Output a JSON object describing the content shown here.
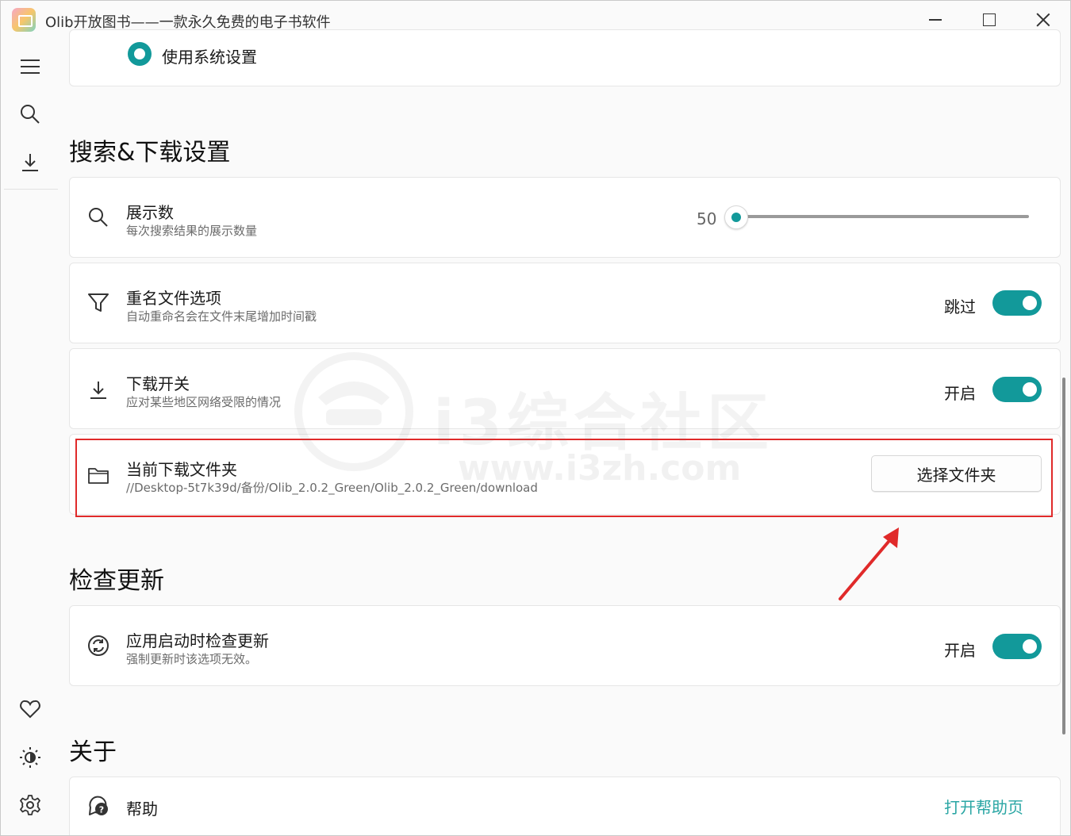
{
  "window": {
    "title": "Olib开放图书——一款永久免费的电子书软件"
  },
  "nav": {
    "icons": [
      "menu-icon",
      "search-icon",
      "download-icon",
      "heart-icon",
      "theme-icon",
      "settings-icon"
    ]
  },
  "theme_option": {
    "label": "使用系统设置",
    "selected": true
  },
  "sections": {
    "search_download": "搜索&下载设置",
    "check_update": "检查更新",
    "about": "关于"
  },
  "display_count": {
    "title": "展示数",
    "desc": "每次搜索结果的展示数量",
    "value": "50"
  },
  "rename_option": {
    "title": "重名文件选项",
    "desc": "自动重命名会在文件末尾增加时间戳",
    "toggle_label": "跳过",
    "on": true
  },
  "download_switch": {
    "title": "下载开关",
    "desc": "应对某些地区网络受限的情况",
    "toggle_label": "开启",
    "on": true
  },
  "download_folder": {
    "title": "当前下载文件夹",
    "path": "//Desktop-5t7k39d/备份/Olib_2.0.2_Green/Olib_2.0.2_Green/download",
    "button": "选择文件夹"
  },
  "auto_update": {
    "title": "应用启动时检查更新",
    "desc": "强制更新时该选项无效。",
    "toggle_label": "开启",
    "on": true
  },
  "help": {
    "title": "帮助",
    "link": "打开帮助页"
  },
  "watermark": {
    "text": "i3综合社区",
    "url": "www.i3zh.com"
  },
  "colors": {
    "accent": "#12999a",
    "highlight": "#e02a2a",
    "link": "#2aa6a4"
  }
}
